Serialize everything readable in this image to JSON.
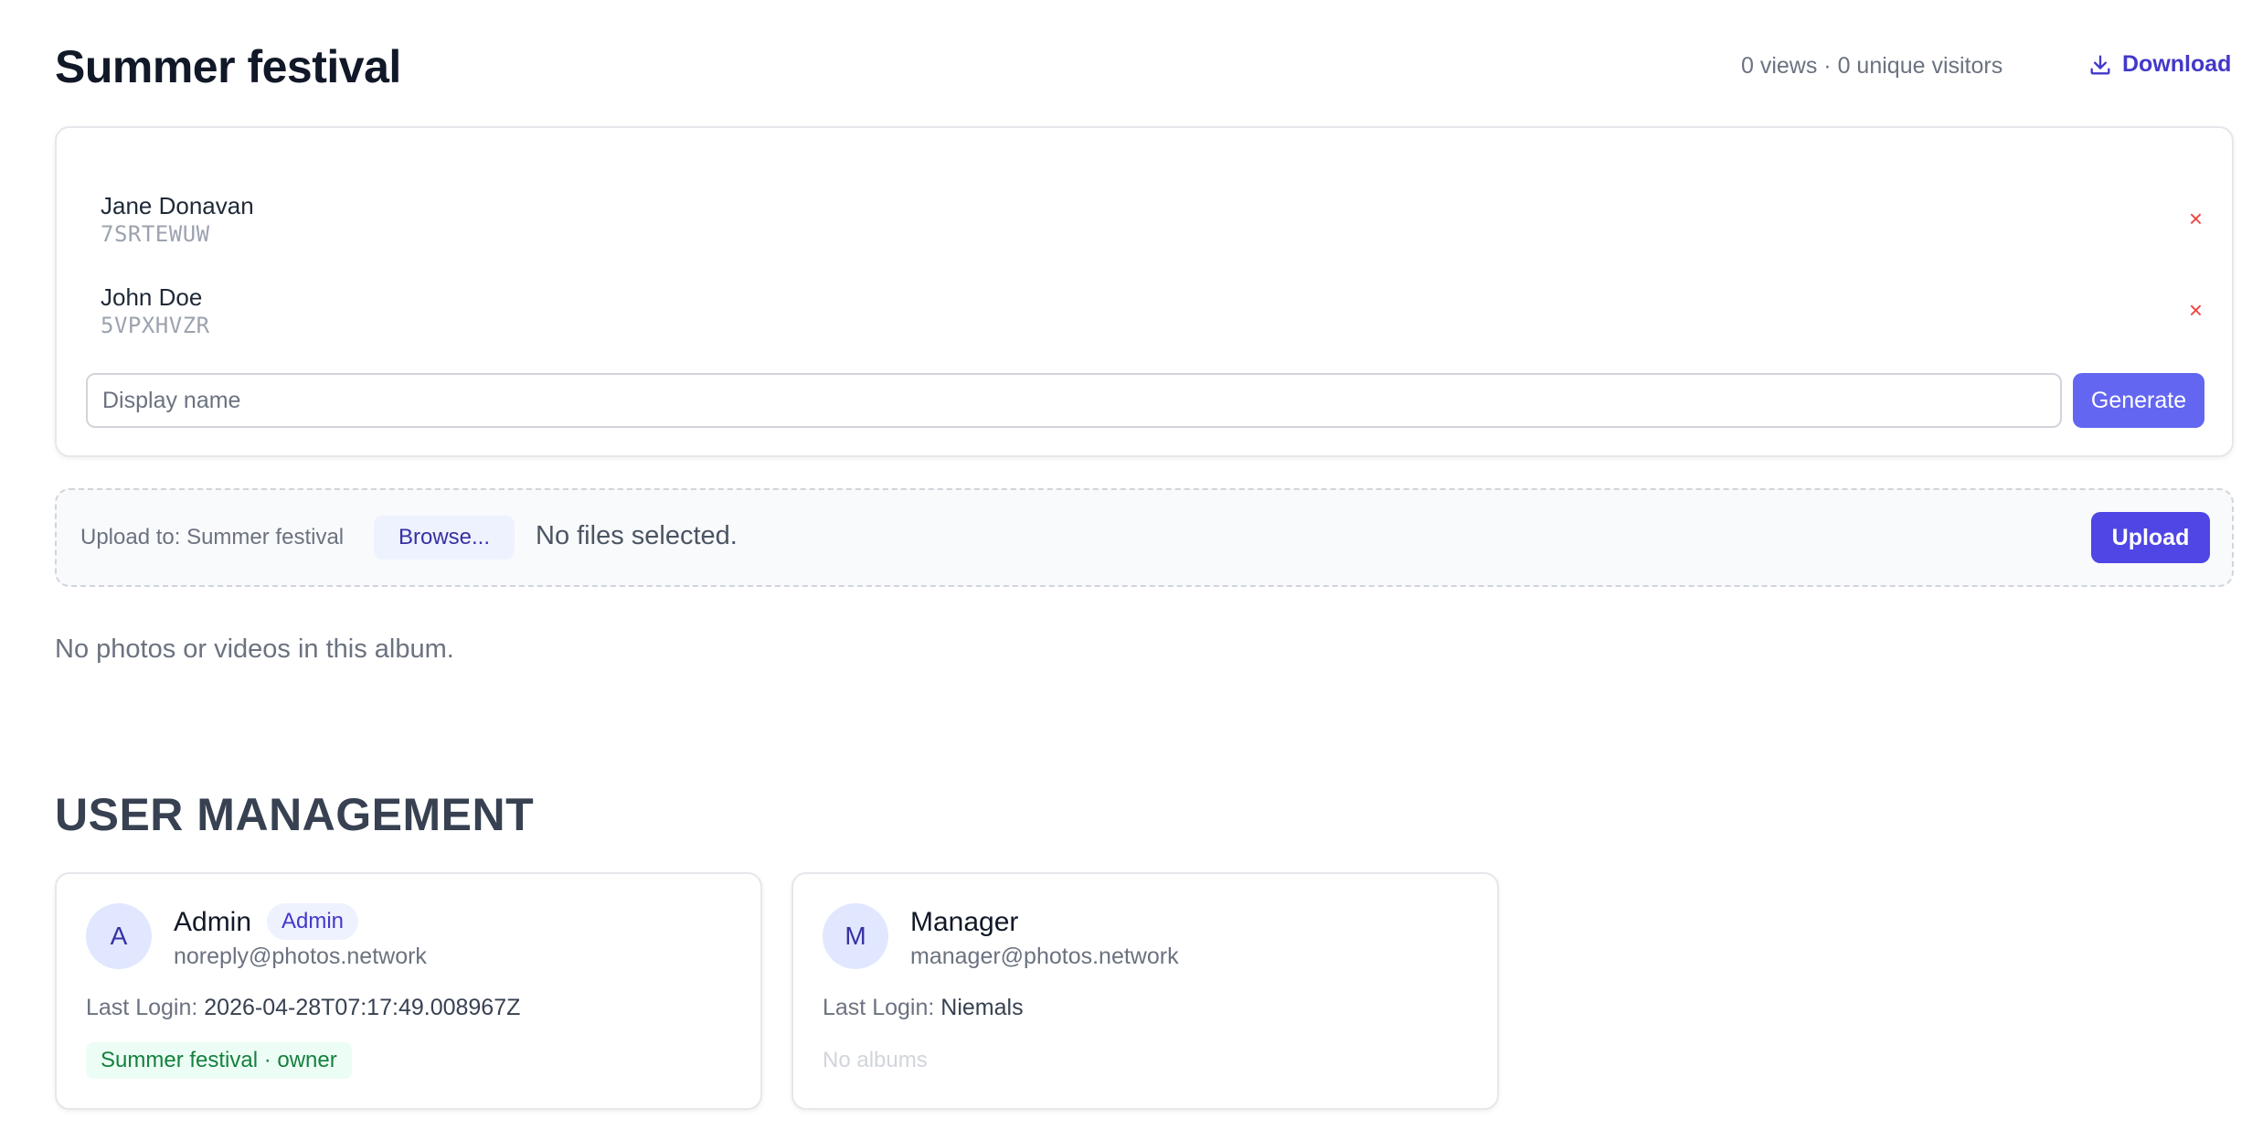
{
  "album": {
    "title": "Summer festival",
    "stats": "0 views · 0 unique visitors",
    "download_label": "Download",
    "collapse_label": "–"
  },
  "share_links": [
    {
      "name": "Jane Donavan",
      "code": "7SRTEWUW",
      "remove_label": "×"
    },
    {
      "name": "John Doe",
      "code": "5VPXHVZR",
      "remove_label": "×"
    }
  ],
  "share_form": {
    "placeholder": "Display name",
    "value": "",
    "generate_label": "Generate"
  },
  "upload": {
    "label": "Upload to: Summer festival",
    "browse_label": "Browse...",
    "file_status": "No files selected.",
    "upload_label": "Upload"
  },
  "empty_message": "No photos or videos in this album.",
  "user_management": {
    "title": "USER MANAGEMENT",
    "users": [
      {
        "initial": "A",
        "name": "Admin",
        "role_badge": "Admin",
        "email": "noreply@photos.network",
        "last_login_label": "Last Login:",
        "last_login": "2026-04-28T07:17:49.008967Z",
        "albums": [
          "Summer festival · owner"
        ]
      },
      {
        "initial": "M",
        "name": "Manager",
        "email": "manager@photos.network",
        "last_login_label": "Last Login:",
        "last_login": "Niemals",
        "no_albums": "No albums"
      }
    ]
  },
  "colors": {
    "accent": "#4f46e5",
    "accent_light": "#6366f1",
    "danger": "#ef4444",
    "success": "#15803d"
  },
  "icons": {
    "download": "download-icon",
    "remove": "close-icon"
  }
}
